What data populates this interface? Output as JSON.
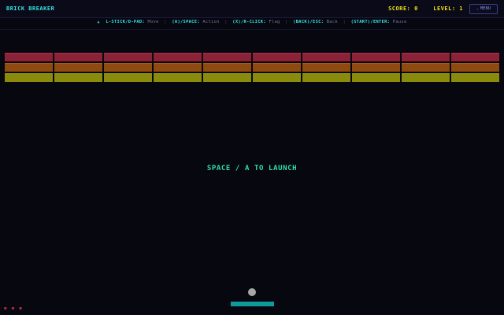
{
  "header": {
    "title": "BRICK BREAKER",
    "score_label": "SCORE:",
    "score_value": "0",
    "level_label": "LEVEL:",
    "level_value": "1",
    "menu_label": "MENU",
    "menu_icon": "chevron-down-icon"
  },
  "controls": [
    {
      "key": "L-STICK/D-PAD:",
      "action": "Move"
    },
    {
      "key": "(A)/SPACE:",
      "action": "Action"
    },
    {
      "key": "(X)/R-CLICK:",
      "action": "Flag"
    },
    {
      "key": "(BACK)/ESC:",
      "action": "Back"
    },
    {
      "key": "(START)/ENTER:",
      "action": "Pause"
    }
  ],
  "game": {
    "launch_message": "SPACE / A TO LAUNCH",
    "brick_rows": 3,
    "brick_cols": 10,
    "brick_colors": [
      "#8c2237",
      "#8f4a12",
      "#8a8a0c"
    ],
    "lives": 3,
    "life_icon": "heart-icon"
  },
  "colors": {
    "accent": "#35e6ea",
    "score": "#f4e21a",
    "launch": "#2fe0a8",
    "paddle": "#109a9a",
    "life": "#c82a45"
  }
}
